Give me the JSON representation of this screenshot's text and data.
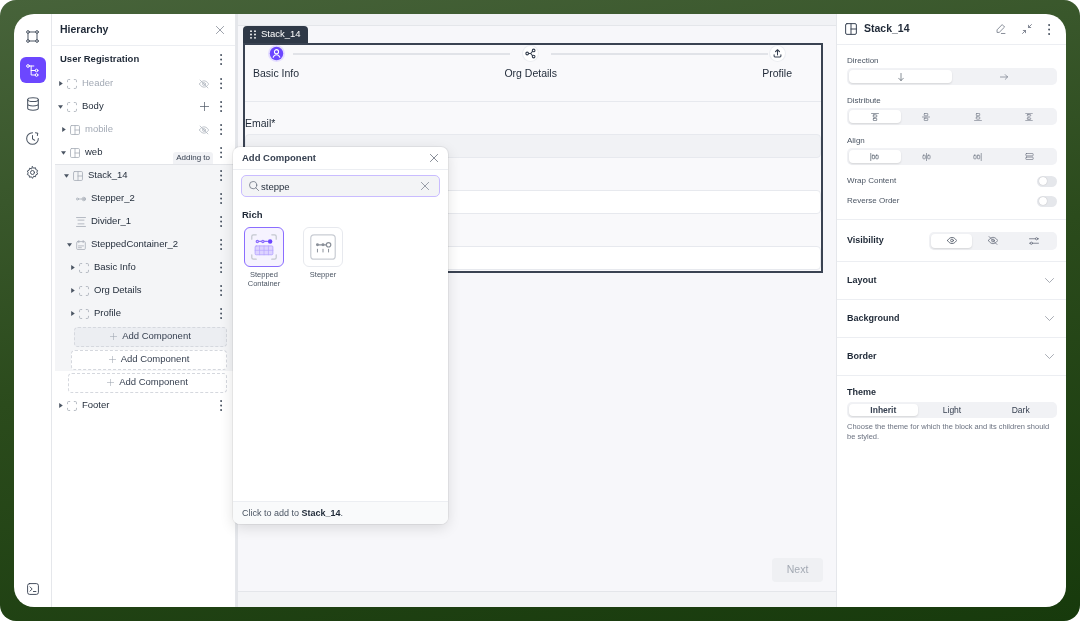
{
  "rail": {
    "items": [
      {
        "selected": false
      },
      {
        "selected": true
      },
      {
        "selected": false
      },
      {
        "selected": false
      },
      {
        "selected": false
      }
    ]
  },
  "hierarchy": {
    "title": "Hierarchy",
    "page": "User Registration",
    "target_label": "Adding to",
    "tree": [
      {
        "label": "Header",
        "kind": "container",
        "selected": false,
        "hidden": true,
        "add_button": false,
        "expanded": false
      },
      {
        "label": "Body",
        "kind": "container",
        "selected": false,
        "hidden": false,
        "add_button": true,
        "expanded": true,
        "children": [
          {
            "label": "mobile",
            "kind": "stack",
            "selected": false,
            "hidden": true,
            "add_button": false,
            "expanded": false
          },
          {
            "label": "web",
            "kind": "stack",
            "selected": false,
            "hidden": false,
            "add_button": false,
            "expanded": true,
            "children": [
              {
                "label": "Stack_14",
                "kind": "stack",
                "selected": true,
                "hidden": false,
                "add_button": false,
                "expanded": true,
                "children": [
                  {
                    "label": "Stepper_2",
                    "kind": "stepper",
                    "selected": false,
                    "hidden": false,
                    "add_button": false
                  },
                  {
                    "label": "Divider_1",
                    "kind": "divider",
                    "selected": false,
                    "hidden": false,
                    "add_button": false
                  },
                  {
                    "label": "SteppedContainer_2",
                    "kind": "stepped_container",
                    "selected": false,
                    "hidden": false,
                    "add_button": false,
                    "expanded": true,
                    "children": [
                      {
                        "label": "Basic Info",
                        "kind": "container",
                        "selected": false,
                        "hidden": false,
                        "add_button": false,
                        "expanded": false
                      },
                      {
                        "label": "Org Details",
                        "kind": "container",
                        "selected": false,
                        "hidden": false,
                        "add_button": false,
                        "expanded": false
                      },
                      {
                        "label": "Profile",
                        "kind": "container",
                        "selected": false,
                        "hidden": false,
                        "add_button": false,
                        "expanded": false
                      },
                      {
                        "label": "Add Component",
                        "kind": "add_slot",
                        "selected": true
                      }
                    ]
                  },
                  {
                    "label": "Add Component",
                    "kind": "add_slot",
                    "selected": false
                  }
                ]
              },
              {
                "label": "Add Component",
                "kind": "add_slot",
                "selected": false
              }
            ]
          }
        ]
      },
      {
        "label": "Footer",
        "kind": "container",
        "selected": false,
        "hidden": false,
        "add_button": false,
        "expanded": false
      }
    ]
  },
  "canvas": {
    "tag": "Stack_14",
    "steps": [
      {
        "label": "Basic Info",
        "selected": true
      },
      {
        "label": "Org Details",
        "selected": false
      },
      {
        "label": "Profile",
        "selected": false
      }
    ],
    "fields": [
      {
        "label": "Email*",
        "disabled": true
      },
      {
        "disabled": false
      },
      {
        "disabled": false
      }
    ],
    "next": {
      "label": "Next",
      "disabled": true
    }
  },
  "add_component": {
    "title": "Add Component",
    "search": {
      "value": "steppe"
    },
    "group": "Rich",
    "items": [
      {
        "label": "Stepped Container",
        "kind": "stepped_container",
        "selected": true
      },
      {
        "label": "Stepper",
        "kind": "stepper",
        "selected": false
      }
    ],
    "footer": "Click to add to **Stack_14**."
  },
  "inspector": {
    "title": "Stack_14",
    "groups": [
      {
        "label": "Direction",
        "options": [
          {
            "selected": true
          },
          {
            "selected": false
          }
        ]
      },
      {
        "label": "Distribute",
        "options": [
          {
            "selected": true
          },
          {
            "selected": false
          },
          {
            "selected": false
          },
          {
            "selected": false
          }
        ]
      },
      {
        "label": "Align",
        "options": [
          {
            "selected": true
          },
          {
            "selected": false
          },
          {
            "selected": false
          },
          {
            "selected": false
          }
        ]
      }
    ],
    "toggles": [
      {
        "label": "Wrap Content",
        "on": false
      },
      {
        "label": "Reverse Order",
        "on": false
      }
    ],
    "visibility": {
      "label": "Visibility",
      "options": [
        {
          "selected": true
        },
        {
          "selected": false
        },
        {
          "selected": false
        }
      ]
    },
    "sections": [
      {
        "label": "Layout",
        "expanded": false
      },
      {
        "label": "Background",
        "expanded": false
      },
      {
        "label": "Border",
        "expanded": false
      }
    ],
    "theme": {
      "label": "Theme",
      "options": [
        {
          "label": "Inherit",
          "selected": true
        },
        {
          "label": "Light",
          "selected": false
        },
        {
          "label": "Dark",
          "selected": false
        }
      ],
      "help": "Choose the theme for which the block and its children should be styled."
    }
  }
}
